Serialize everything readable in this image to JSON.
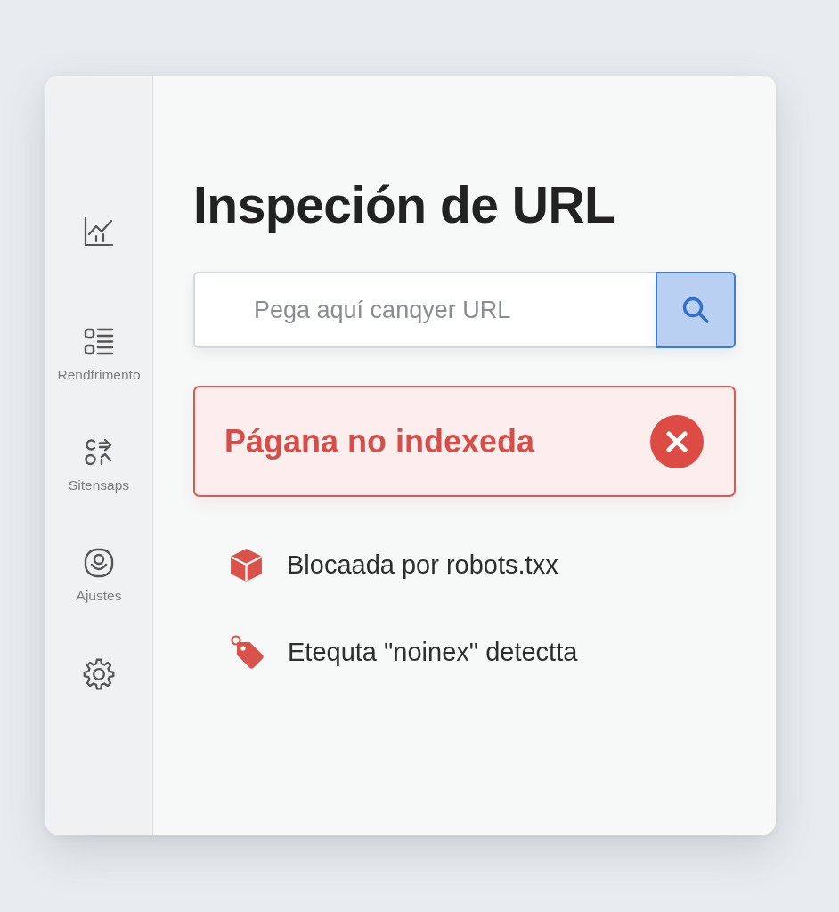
{
  "sidebar": {
    "items": [
      {
        "kind": "chart"
      },
      {
        "kind": "list",
        "label": "Rendfrimento"
      },
      {
        "kind": "sitemap",
        "label": "Sitensaps"
      },
      {
        "kind": "account",
        "label": "Ajustes"
      },
      {
        "kind": "settings"
      }
    ]
  },
  "main": {
    "title": "Inspeción de URL",
    "search": {
      "placeholder": "Pega aquí canqyer URL"
    },
    "status": {
      "text": "Págana no indexeda"
    },
    "issues": [
      {
        "kind": "blocked",
        "text": "Blocaada por robots.txx"
      },
      {
        "kind": "tag",
        "text": "Etequta \"noinex\" detectta"
      }
    ]
  }
}
